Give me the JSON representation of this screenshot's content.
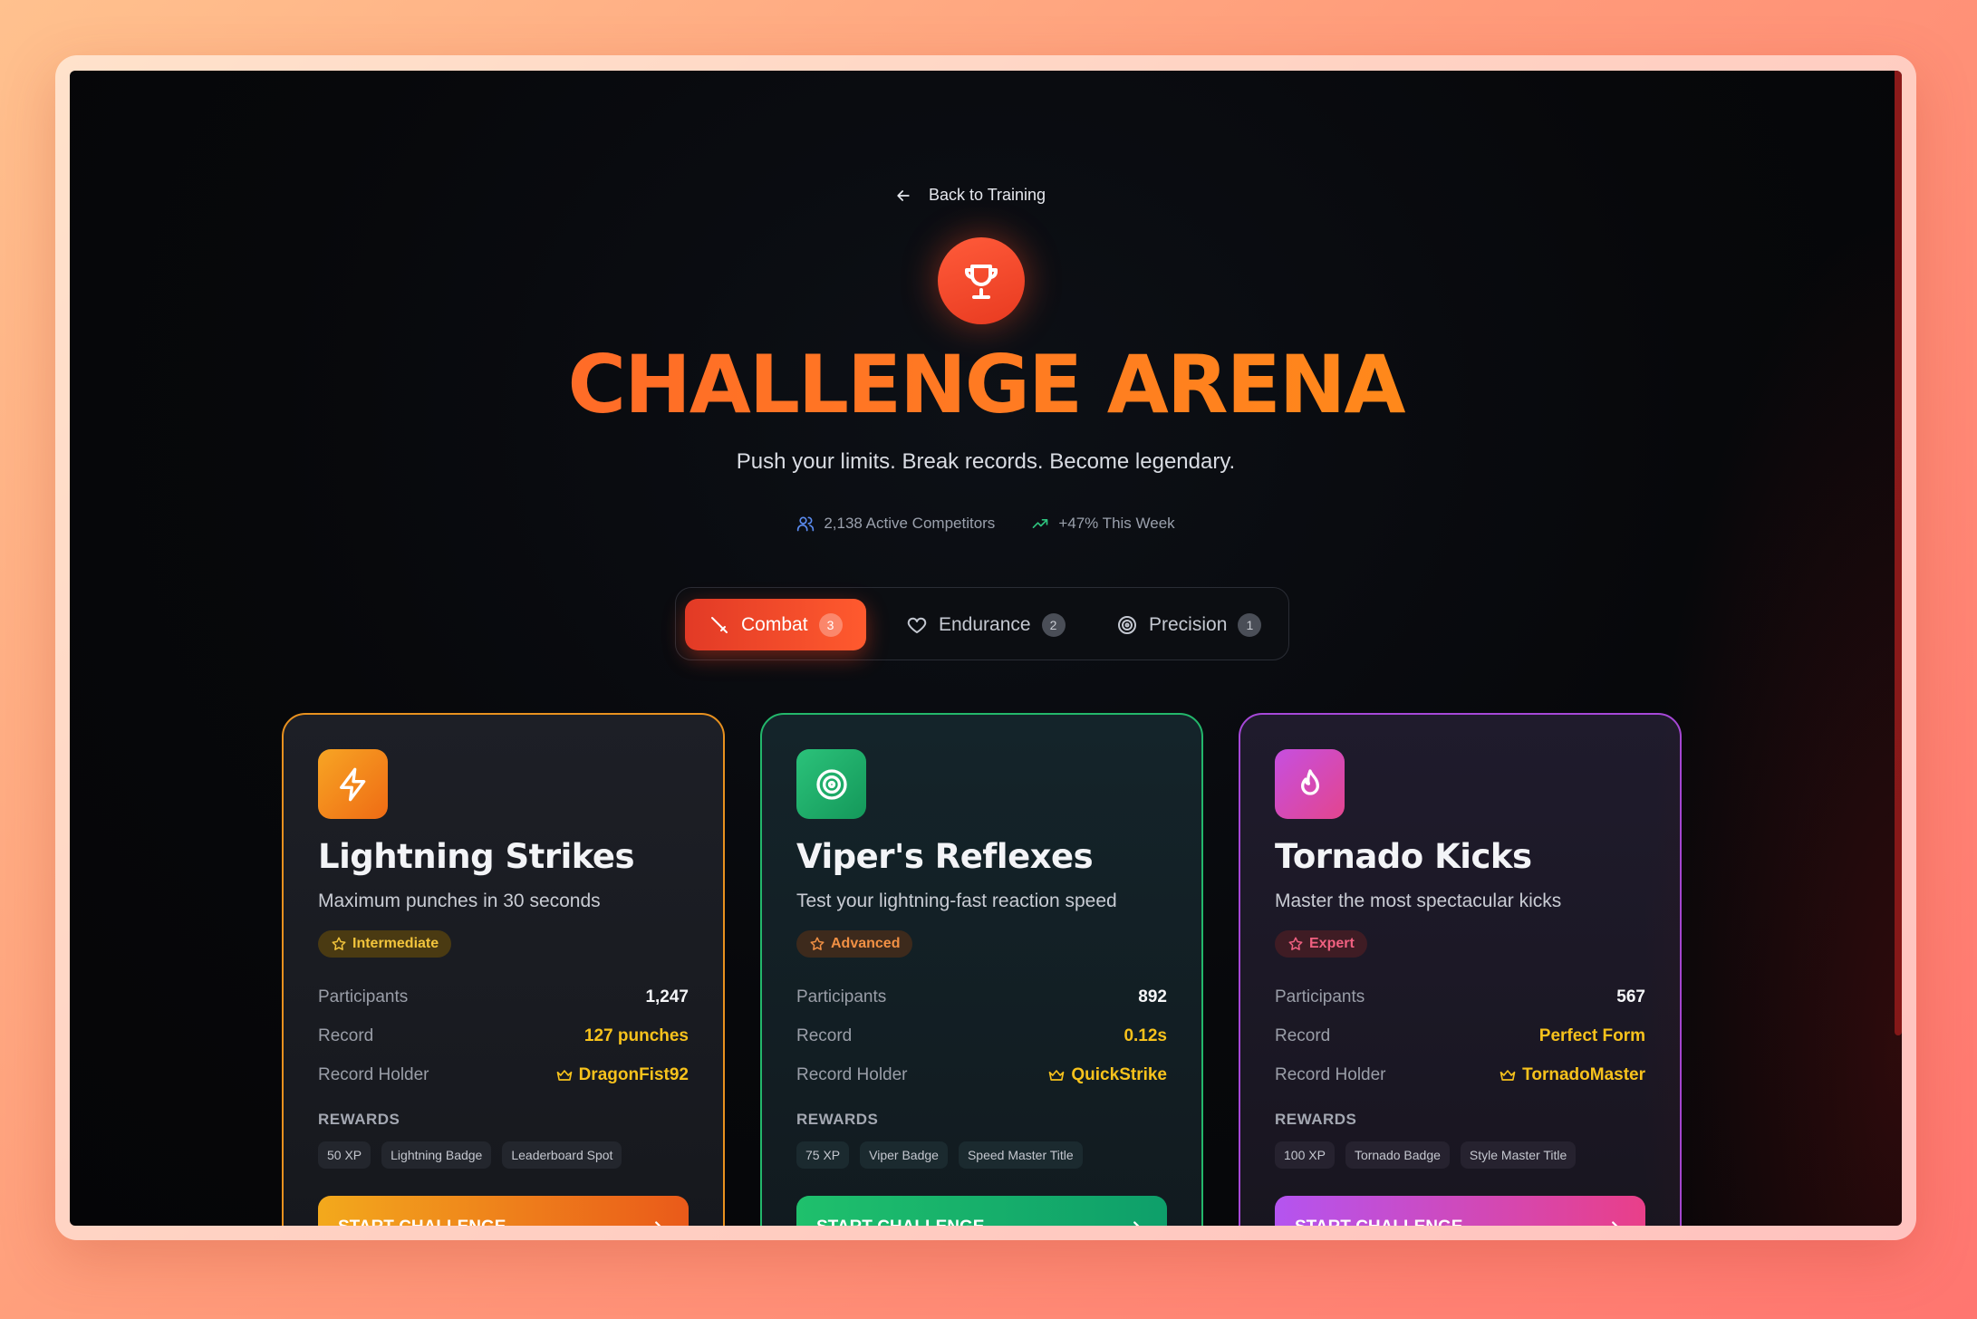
{
  "back": {
    "label": "Back to Training"
  },
  "hero": {
    "title": "CHALLENGE ARENA",
    "subtitle": "Push your limits. Break records. Become legendary."
  },
  "stats": {
    "competitors": "2,138 Active Competitors",
    "growth": "+47% This Week"
  },
  "tabs": [
    {
      "label": "Combat",
      "count": "3",
      "icon": "sword-icon",
      "active": true
    },
    {
      "label": "Endurance",
      "count": "2",
      "icon": "heart-icon",
      "active": false
    },
    {
      "label": "Precision",
      "count": "1",
      "icon": "target-icon",
      "active": false
    }
  ],
  "cards": [
    {
      "title": "Lightning Strikes",
      "description": "Maximum punches in 30 seconds",
      "level": "Intermediate",
      "icon": "lightning-icon",
      "participants_label": "Participants",
      "participants": "1,247",
      "record_label": "Record",
      "record": "127 punches",
      "holder_label": "Record Holder",
      "holder": "DragonFist92",
      "rewards_label": "REWARDS",
      "rewards": [
        "50 XP",
        "Lightning Badge",
        "Leaderboard Spot"
      ],
      "button": "START CHALLENGE"
    },
    {
      "title": "Viper's Reflexes",
      "description": "Test your lightning-fast reaction speed",
      "level": "Advanced",
      "icon": "target-icon",
      "participants_label": "Participants",
      "participants": "892",
      "record_label": "Record",
      "record": "0.12s",
      "holder_label": "Record Holder",
      "holder": "QuickStrike",
      "rewards_label": "REWARDS",
      "rewards": [
        "75 XP",
        "Viper Badge",
        "Speed Master Title"
      ],
      "button": "START CHALLENGE"
    },
    {
      "title": "Tornado Kicks",
      "description": "Master the most spectacular kicks",
      "level": "Expert",
      "icon": "flame-icon",
      "participants_label": "Participants",
      "participants": "567",
      "record_label": "Record",
      "record": "Perfect Form",
      "holder_label": "Record Holder",
      "holder": "TornadoMaster",
      "rewards_label": "REWARDS",
      "rewards": [
        "100 XP",
        "Tornado Badge",
        "Style Master Title"
      ],
      "button": "START CHALLENGE"
    }
  ]
}
